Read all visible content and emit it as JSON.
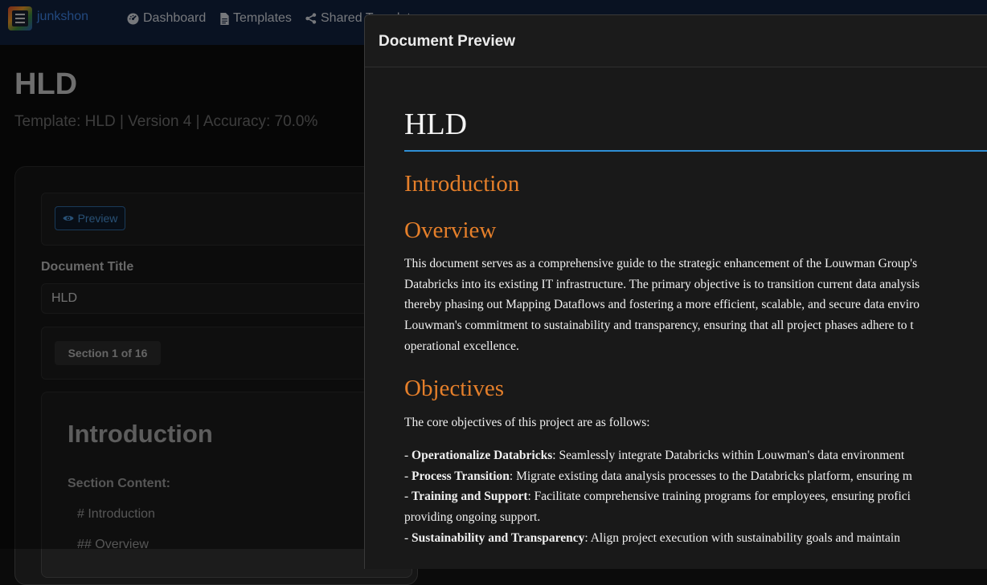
{
  "navbar": {
    "brand": "junkshon",
    "links": [
      {
        "label": "Dashboard",
        "icon": "dashboard-gauge-icon"
      },
      {
        "label": "Templates",
        "icon": "document-icon"
      },
      {
        "label": "Shared Templates",
        "icon": "share-icon"
      }
    ]
  },
  "page": {
    "title": "HLD",
    "subtitle": "Template: HLD | Version 4 | Accuracy: 70.0%",
    "preview_button": "Preview",
    "document_title_label": "Document Title",
    "document_title_value": "HLD",
    "section_badge": "Section 1 of 16",
    "section_heading": "Introduction",
    "section_content_label": "Section Content:",
    "section_content_lines": [
      "# Introduction",
      "## Overview"
    ]
  },
  "modal": {
    "title": "Document Preview",
    "doc": {
      "h1": "HLD",
      "intro_heading": "Introduction",
      "overview_heading": "Overview",
      "overview_lines": [
        "This document serves as a comprehensive guide to the strategic enhancement of the Louwman Group's",
        "Databricks into its existing IT infrastructure. The primary objective is to transition current data analysis",
        "thereby phasing out Mapping Dataflows and fostering a more efficient, scalable, and secure data enviro",
        "Louwman's commitment to sustainability and transparency, ensuring that all project phases adhere to t",
        "operational excellence."
      ],
      "objectives_heading": "Objectives",
      "objectives_intro": "The core objectives of this project are as follows:",
      "objectives": [
        {
          "prefix": "- ",
          "bold": "Operationalize Databricks",
          "rest": ": Seamlessly integrate Databricks within Louwman's data environment"
        },
        {
          "prefix": "- ",
          "bold": "Process Transition",
          "rest": ": Migrate existing data analysis processes to the Databricks platform, ensuring m"
        },
        {
          "prefix": "- ",
          "bold": "Training and Support",
          "rest": ": Facilitate comprehensive training programs for employees, ensuring profici"
        },
        {
          "prefix": "",
          "bold": "",
          "rest": "providing ongoing support."
        },
        {
          "prefix": "- ",
          "bold": "Sustainability and Transparency",
          "rest": ": Align project execution with sustainability goals and maintain"
        }
      ]
    }
  },
  "colors": {
    "navbar_bg": "#11213f",
    "brand": "#3f84e5",
    "heading_orange": "#e57f2a",
    "rule_blue": "#2f8fd6",
    "preview_button": "#4a93d6"
  }
}
